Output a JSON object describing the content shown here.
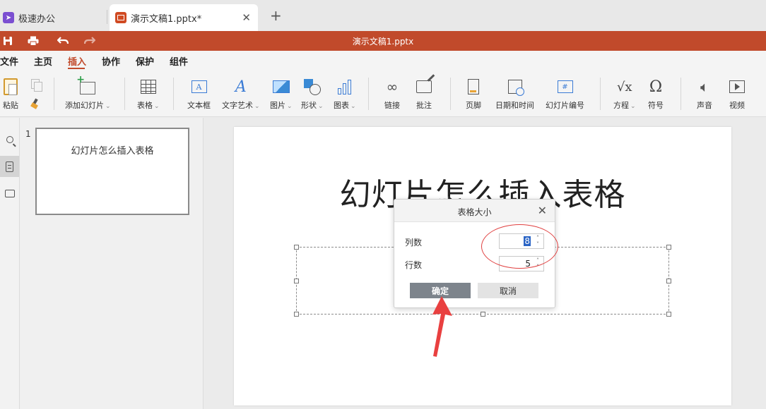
{
  "browser_tabs": [
    {
      "label": "极速办公",
      "active": false
    },
    {
      "label": "演示文稿1.pptx*",
      "active": true
    }
  ],
  "new_tab_icon": "plus-icon",
  "title_bar": {
    "document_name": "演示文稿1.pptx",
    "color": "#c14a2b"
  },
  "quick_access": [
    "save-icon",
    "print-icon",
    "undo-icon",
    "redo-icon"
  ],
  "menu": {
    "items": [
      "文件",
      "主页",
      "插入",
      "协作",
      "保护",
      "组件"
    ],
    "active": "插入"
  },
  "ribbon": {
    "paste": "粘贴",
    "add_slide": "添加幻灯片",
    "table": "表格",
    "textbox": "文本框",
    "wordart": "文字艺术",
    "image": "图片",
    "shape": "形状",
    "chart": "图表",
    "link": "链接",
    "comment": "批注",
    "footer": "页脚",
    "datetime": "日期和时间",
    "slide_number": "幻灯片编号",
    "equation": "方程",
    "symbol": "符号",
    "audio": "声音",
    "video": "视频",
    "textbox_glyph": "A",
    "slide_number_glyph": "#",
    "equation_glyph": "√x",
    "symbol_glyph": "Ω"
  },
  "thumbnails": [
    {
      "number": "1",
      "title": "幻灯片怎么插入表格"
    }
  ],
  "slide": {
    "title": "幻灯片怎么插入表格"
  },
  "dialog": {
    "title": "表格大小",
    "columns_label": "列数",
    "columns_value": "8",
    "rows_label": "行数",
    "rows_value": "5",
    "ok": "确定",
    "cancel": "取消"
  },
  "colors": {
    "accent": "#c14a2b",
    "annotation": "#e04040"
  }
}
